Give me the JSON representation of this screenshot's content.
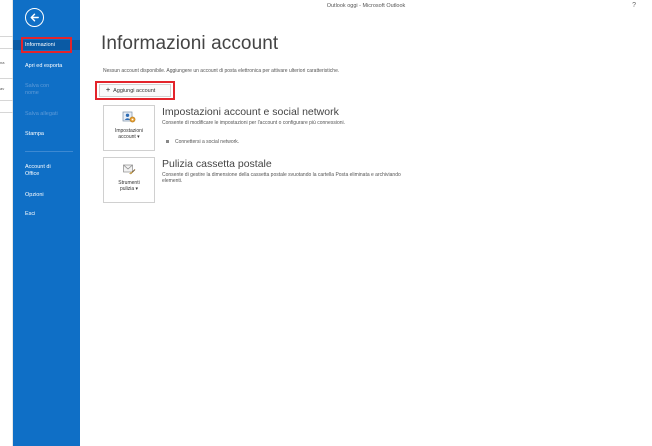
{
  "window": {
    "title": "Outlook oggi - Microsoft Outlook",
    "help": "?"
  },
  "underlay": {
    "text1": "na",
    "text2": "av",
    "text3": "lav"
  },
  "nav": {
    "back_icon": "back-arrow-icon",
    "items": [
      {
        "label": "Informazioni",
        "state": "selected"
      },
      {
        "label": "Apri ed esporta",
        "state": "normal"
      },
      {
        "label": "Salva con nome",
        "state": "disabled"
      },
      {
        "label": "Salva allegati",
        "state": "disabled"
      },
      {
        "label": "Stampa",
        "state": "normal"
      },
      {
        "label": "Account di Office",
        "state": "normal"
      },
      {
        "label": "Opzioni",
        "state": "normal"
      },
      {
        "label": "Esci",
        "state": "normal"
      }
    ],
    "colors": {
      "background": "#0f6fc6",
      "selected": "#0a5aa4",
      "highlight_border": "#e3242b"
    }
  },
  "main": {
    "title": "Informazioni account",
    "no_account_text": "Nessun account disponibile. Aggiungere un account di posta elettronica per attivare ulteriori caratteristiche.",
    "add_account_label": "Aggiungi account",
    "sections": [
      {
        "tile_label_1": "Impostazioni",
        "tile_label_2": "account",
        "tile_icon": "account-settings-icon",
        "title": "Impostazioni account e social network",
        "description": "Consente di modificare le impostazioni per l'account o configurare più connessioni.",
        "bullet": "Connettersi a social network."
      },
      {
        "tile_label_1": "Strumenti",
        "tile_label_2": "pulizia",
        "tile_icon": "mailbox-cleanup-icon",
        "title": "Pulizia cassetta postale",
        "description": "Consente di gestire la dimensione della cassetta postale svuotando la cartella Posta eliminata e archiviando elementi."
      }
    ]
  }
}
